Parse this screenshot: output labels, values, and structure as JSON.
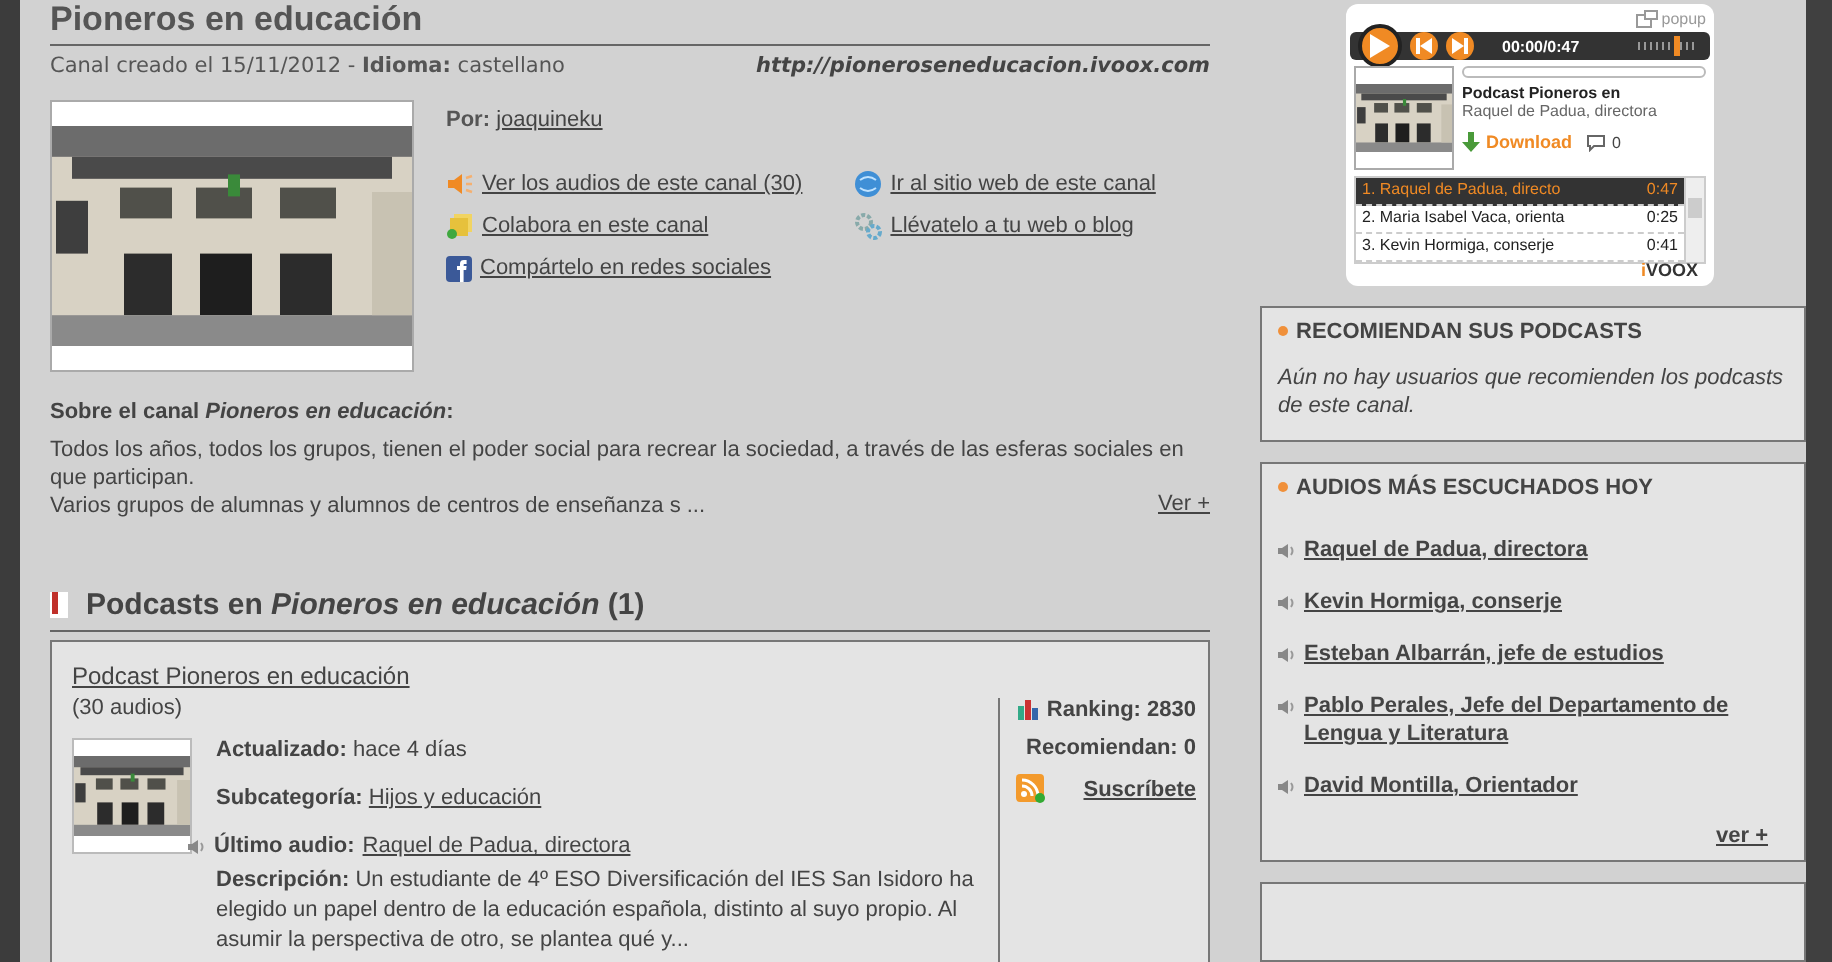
{
  "channel": {
    "title": "Pioneros en educación",
    "created": "Canal creado el 15/11/2012 -",
    "language_label": "Idioma:",
    "language": "castellano",
    "url": "http://pioneroseneducacion.ivoox.com",
    "author_label": "Por:",
    "author": "joaquineku",
    "links": [
      {
        "kind": "speaker",
        "label": "Ver los audios de este canal (30)"
      },
      {
        "kind": "globe",
        "label": "Ir al sitio web de este canal"
      },
      {
        "kind": "collaborate",
        "label": "Colabora en este canal"
      },
      {
        "kind": "embed",
        "label": "Llévatelo a tu web o blog"
      },
      {
        "kind": "facebook",
        "label": "Compártelo en redes sociales"
      }
    ],
    "about_title": "Sobre el canal *Pioneros en educación*:",
    "about_text": "Todos los años, todos los grupos, tienen el poder social para recrear la sociedad, a través de las esferas sociales en que participan.",
    "about_text_2": "Varios grupos de alumnas y alumnos de centros de enseñanza s ...",
    "more": "Ver +"
  },
  "podcasts": {
    "heading": "Podcasts en *Pioneros en educación* (1)",
    "items": [
      {
        "title": "Podcast Pioneros en educación",
        "count": "(30 audios)",
        "updated_label": "Actualizado:",
        "updated": "hace 4 días",
        "subcategory_label": "Subcategoría:",
        "subcategory": "Hijos y educación",
        "last_label": "Último audio:",
        "last": "Raquel de Padua, directora",
        "description": "**Descripción:** Un estudiante de 4º ESO Diversificación del IES San Isidoro ha elegido un papel dentro de la educación española, distinto al suyo propio. Al asumir la perspectiva de otro, se plantea qué y...",
        "ranking": "Ranking: 2830",
        "recommend": "Recomiendan: 0",
        "subscribe": "Suscríbete"
      }
    ]
  },
  "player": {
    "popup": "popup",
    "time": "00:00/0:47",
    "progress": {
      "level": 0
    },
    "volume": {
      "level": 0.6
    },
    "title": "Podcast Pioneros en",
    "subtitle": "Raquel de Padua, directora",
    "download": "Download",
    "comments": "0",
    "playlist": [
      {
        "label": "1. Raquel de Padua, directo",
        "time": "0:47",
        "selected": true
      },
      {
        "label": "2. Maria Isabel Vaca, orienta",
        "time": "0:25",
        "selected": false
      },
      {
        "label": "3. Kevin Hormiga, conserje",
        "time": "0:41",
        "selected": false
      }
    ],
    "logo_mark": "i",
    "logo_text": "VOOX"
  },
  "recommend_box": {
    "title": "RECOMIENDAN SUS PODCASTS",
    "text": "Aún no hay usuarios que recomienden los podcasts de este canal."
  },
  "top_box": {
    "title": "AUDIOS MÁS ESCUCHADOS HOY",
    "items": [
      "Raquel de Padua, directora",
      "Kevin Hormiga, conserje",
      "Esteban Albarrán, jefe de estudios",
      "Pablo Perales, Jefe del Departamento de Lengua y Literatura",
      "David Montilla, Orientador"
    ],
    "more": "ver +"
  }
}
